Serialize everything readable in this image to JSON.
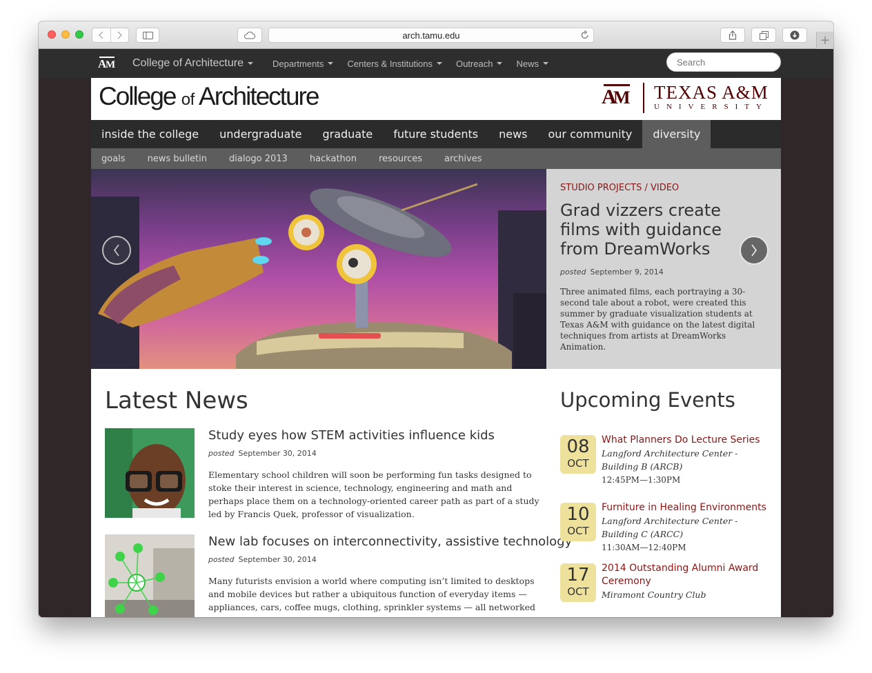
{
  "browser": {
    "url": "arch.tamu.edu"
  },
  "topbar": {
    "logo_text": "ĀM",
    "site_name": "College of Architecture",
    "menu": [
      "Departments",
      "Centers & Institutions",
      "Outreach",
      "News"
    ],
    "search_placeholder": "Search"
  },
  "brand": {
    "title_pre": "College",
    "title_of": "of",
    "title_post": "Architecture",
    "tamu_mark": "ĀM",
    "tamu_line1": "TEXAS A&M",
    "tamu_line2": "UNIVERSITY",
    "tamu_color": "#500000"
  },
  "main_nav": [
    "inside the college",
    "undergraduate",
    "graduate",
    "future students",
    "news",
    "our community",
    "diversity"
  ],
  "main_nav_active": "diversity",
  "sub_nav": [
    "goals",
    "news bulletin",
    "dialogo 2013",
    "hackathon",
    "resources",
    "archives"
  ],
  "hero": {
    "kicker": "STUDIO PROJECTS / VIDEO",
    "title": "Grad vizzers create films with guidance from DreamWorks",
    "posted_label": "posted",
    "date": "September 9, 2014",
    "description": "Three animated films, each portraying a 30-second tale about a robot, were created this summer by graduate visualization students at Texas A&M with guidance on the latest digital techniques from artists at DreamWorks Animation.",
    "prev_icon": "chevron-left-icon",
    "next_icon": "chevron-right-icon"
  },
  "latest_news": {
    "heading": "Latest News",
    "items": [
      {
        "title": "Study eyes how STEM activities influence kids",
        "posted_label": "posted",
        "date": "September 30, 2014",
        "description": "Elementary school children will soon be performing fun tasks designed to stoke their interest in science, technology, engineering and math and perhaps place them on a technology-oriented career path as part of a study led by Francis Quek, professor of visualization."
      },
      {
        "title": "New lab focuses on interconnectivity, assistive technology",
        "posted_label": "posted",
        "date": "September 30, 2014",
        "description": "Many futurists envision a world where computing isn’t limited to desktops and mobile devices but rather a ubiquitous function of everyday items — appliances, cars, coffee mugs, clothing, sprinkler systems — all networked into an “Internet of"
      }
    ]
  },
  "events": {
    "heading": "Upcoming Events",
    "items": [
      {
        "day": "08",
        "month": "OCT",
        "title": "What Planners Do Lecture Series",
        "location": "Langford Architecture Center - Building B (ARCB)",
        "time": "12:45PM—1:30PM"
      },
      {
        "day": "10",
        "month": "OCT",
        "title": "Furniture in Healing Environments",
        "location": "Langford Architecture Center - Building C (ARCC)",
        "time": "11:30AM—12:40PM"
      },
      {
        "day": "17",
        "month": "OCT",
        "title": "2014 Outstanding Alumni Award Ceremony",
        "location": "Miramont Country Club",
        "time": ""
      }
    ]
  },
  "colors": {
    "accent_maroon": "#8b1515",
    "date_badge": "#ede19c",
    "nav_dark": "#2b2b2b",
    "subnav_gray": "#5d5d5d"
  }
}
